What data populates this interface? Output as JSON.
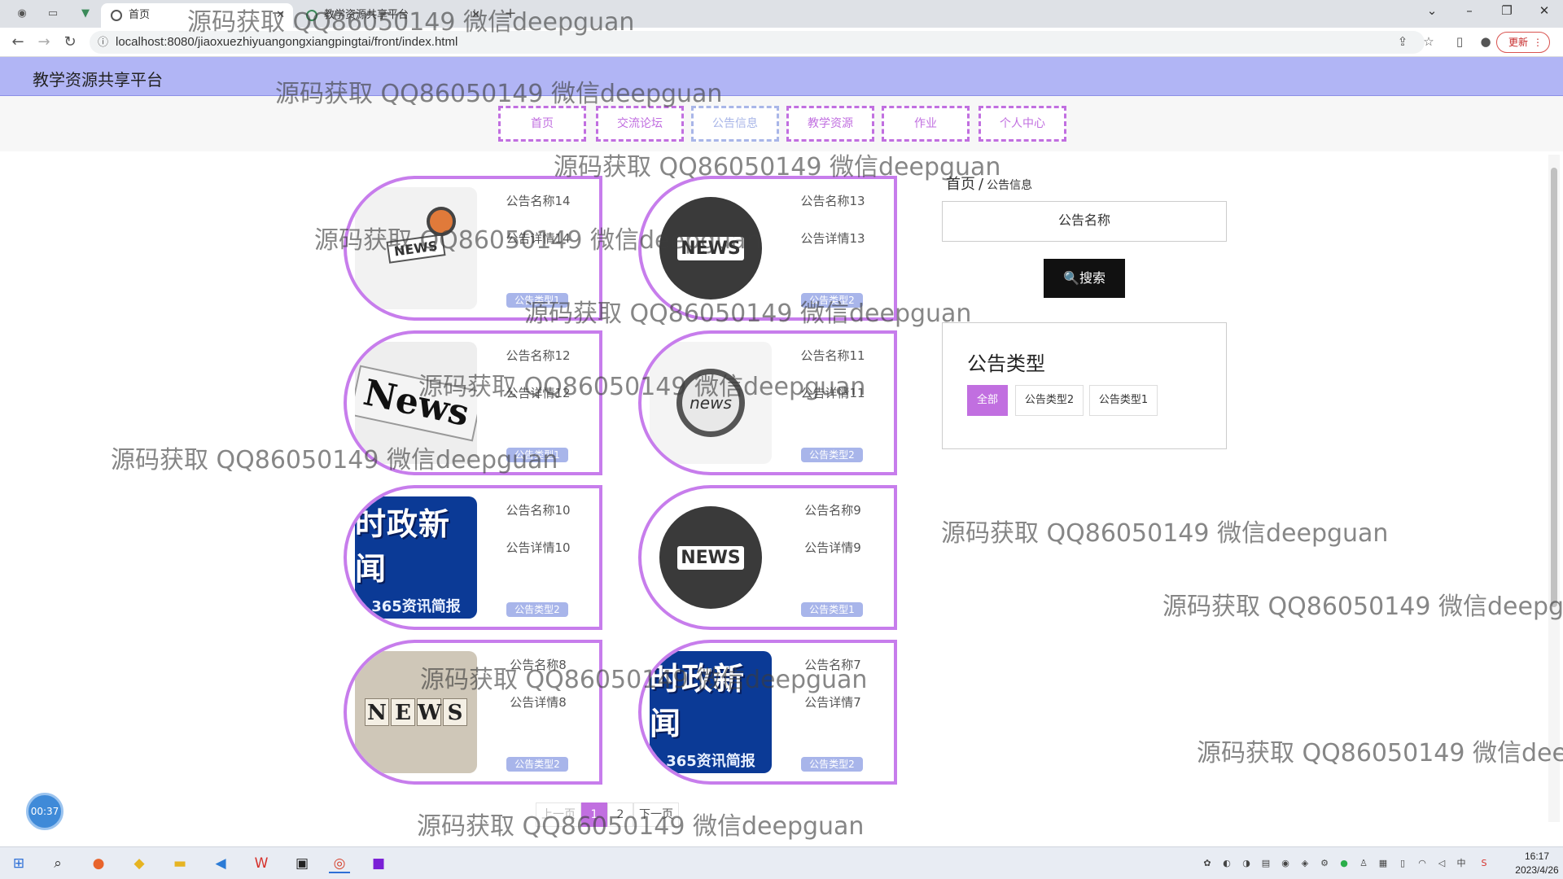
{
  "browser": {
    "tabs": [
      {
        "label": "首页",
        "active": true
      },
      {
        "label": "教学资源共享平台",
        "active": false
      }
    ],
    "new_tab": "+",
    "url": "localhost:8080/jiaoxuezhiyuangongxiangpingtai/front/index.html",
    "update_label": "更新"
  },
  "site": {
    "title": "教学资源共享平台",
    "nav": [
      {
        "label": "首页",
        "active": false
      },
      {
        "label": "交流论坛",
        "active": false
      },
      {
        "label": "公告信息",
        "active": true
      },
      {
        "label": "教学资源",
        "active": false
      },
      {
        "label": "作业",
        "active": false
      },
      {
        "label": "个人中心",
        "active": false
      }
    ]
  },
  "cards": [
    {
      "title": "公告名称14",
      "detail": "公告详情14",
      "tag": "公告类型1",
      "image": "news-desk-image"
    },
    {
      "title": "公告名称13",
      "detail": "公告详情13",
      "tag": "公告类型2",
      "image": "news-globe-image",
      "image_text": "NEWS"
    },
    {
      "title": "公告名称12",
      "detail": "公告详情12",
      "tag": "公告类型1",
      "image": "newspaper-image",
      "image_text": "News"
    },
    {
      "title": "公告名称11",
      "detail": "公告详情11",
      "tag": "公告类型2",
      "image": "magnifier-news-image",
      "image_text": "news"
    },
    {
      "title": "公告名称10",
      "detail": "公告详情10",
      "tag": "公告类型2",
      "image": "shizheng-news-image",
      "image_text": "时政新闻",
      "image_subtext": "365资讯简报"
    },
    {
      "title": "公告名称9",
      "detail": "公告详情9",
      "tag": "公告类型1",
      "image": "news-globe-image",
      "image_text": "NEWS"
    },
    {
      "title": "公告名称8",
      "detail": "公告详情8",
      "tag": "公告类型2",
      "image": "news-cubes-image",
      "image_letters": [
        "N",
        "E",
        "W",
        "S"
      ]
    },
    {
      "title": "公告名称7",
      "detail": "公告详情7",
      "tag": "公告类型2",
      "image": "shizheng-news-image",
      "image_text": "时政新闻",
      "image_subtext": "365资讯简报"
    }
  ],
  "sidebar": {
    "breadcrumb_home": "首页",
    "breadcrumb_sep": "/",
    "breadcrumb_current": "公告信息",
    "search_placeholder": "公告名称",
    "search_button": "搜索",
    "type_title": "公告类型",
    "types": [
      {
        "label": "全部",
        "active": true
      },
      {
        "label": "公告类型2",
        "active": false
      },
      {
        "label": "公告类型1",
        "active": false
      }
    ]
  },
  "pager": {
    "prev": "上一页",
    "pages": [
      "1",
      "2"
    ],
    "current_page": "1",
    "next": "下一页"
  },
  "timer": "00:37",
  "taskbar": {
    "time": "16:17",
    "date": "2023/4/26",
    "ime": "中"
  },
  "watermark_text": "源码获取 QQ86050149 微信deepguan",
  "colors": {
    "accent": "#c16fe0",
    "header_bg": "#b1b5f5",
    "tag_bg": "#a8b5ea",
    "search_btn": "#111111"
  }
}
